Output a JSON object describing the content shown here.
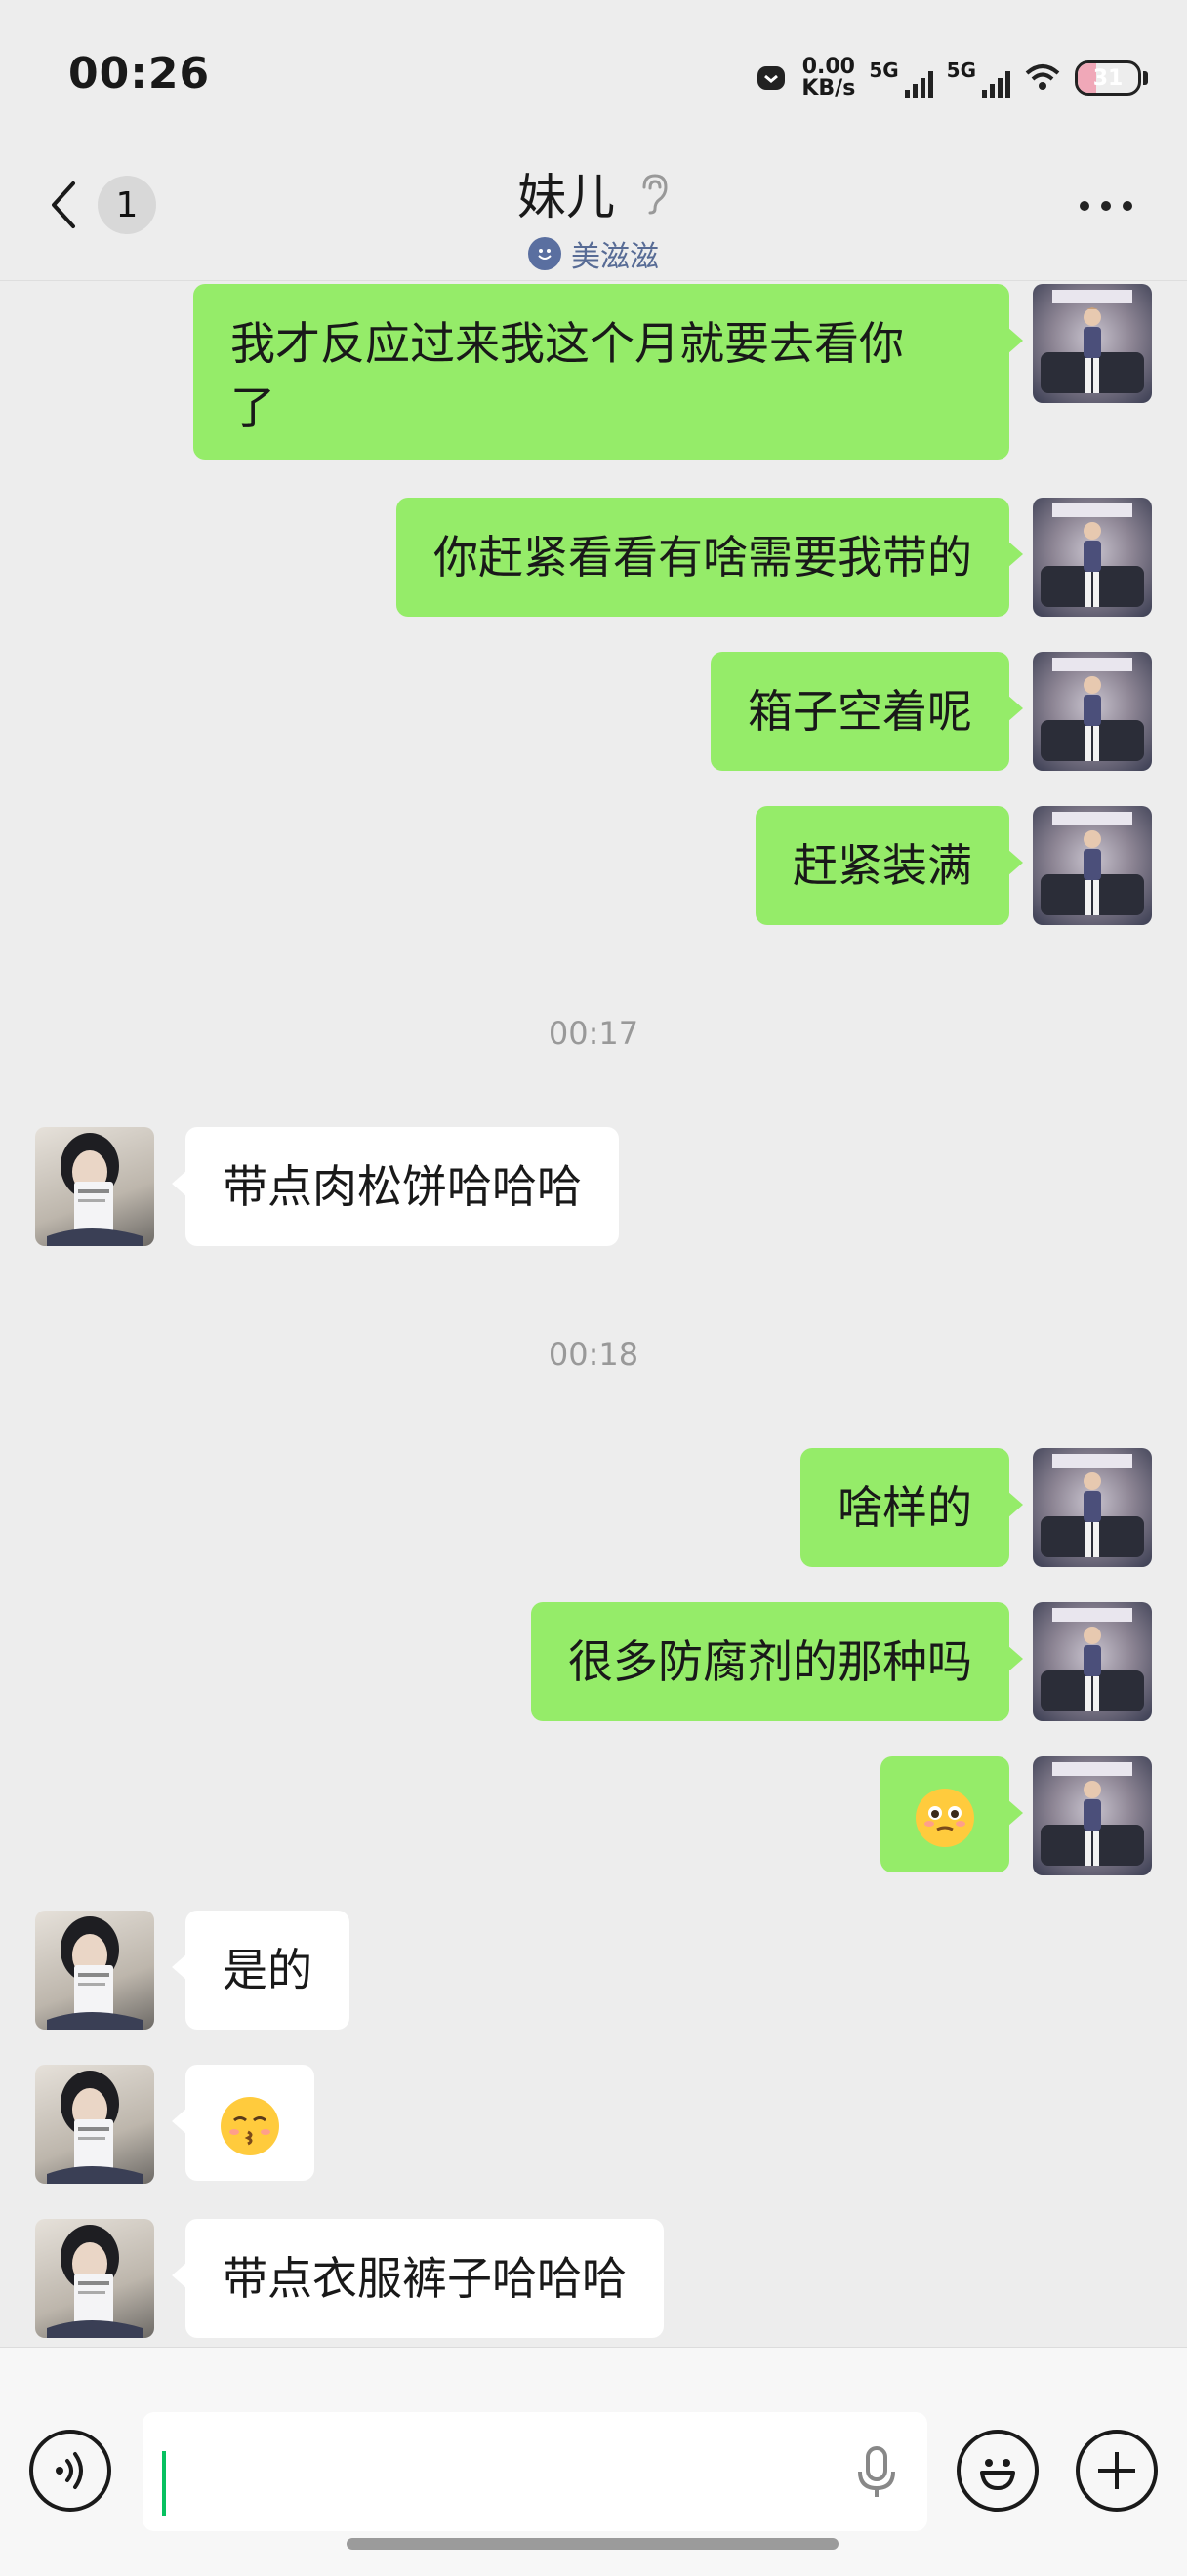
{
  "status_bar": {
    "time": "00:26",
    "speed_value": "0.00",
    "speed_unit": "KB/s",
    "sim1_network": "5G",
    "sim2_network": "5G",
    "battery": "31"
  },
  "header": {
    "unread_count": "1",
    "contact_name": "妹儿",
    "status_text": "美滋滋"
  },
  "messages": [
    {
      "side": "me",
      "text": "我才反应过来我这个月就要去看你了",
      "line1": "我才反应过来我这个月就要去看你",
      "line2": "了"
    },
    {
      "side": "me",
      "text": "你赶紧看看有啥需要我带的"
    },
    {
      "side": "me",
      "text": "箱子空着呢"
    },
    {
      "side": "me",
      "text": "赶紧装满"
    },
    {
      "type": "time",
      "text": "00:17"
    },
    {
      "side": "them",
      "text": "带点肉松饼哈哈哈"
    },
    {
      "type": "time",
      "text": "00:18"
    },
    {
      "side": "me",
      "text": "啥样的"
    },
    {
      "side": "me",
      "text": "很多防腐剂的那种吗"
    },
    {
      "side": "me",
      "emoji": "pleading-face-emoji"
    },
    {
      "side": "them",
      "text": "是的"
    },
    {
      "side": "them",
      "emoji": "kissing-face-emoji"
    },
    {
      "side": "them",
      "text": "带点衣服裤子哈哈哈"
    }
  ],
  "input": {
    "value": ""
  },
  "colors": {
    "my_bubble": "#95ec69",
    "their_bubble": "#ffffff",
    "background": "#ededed",
    "caret": "#07c160"
  }
}
